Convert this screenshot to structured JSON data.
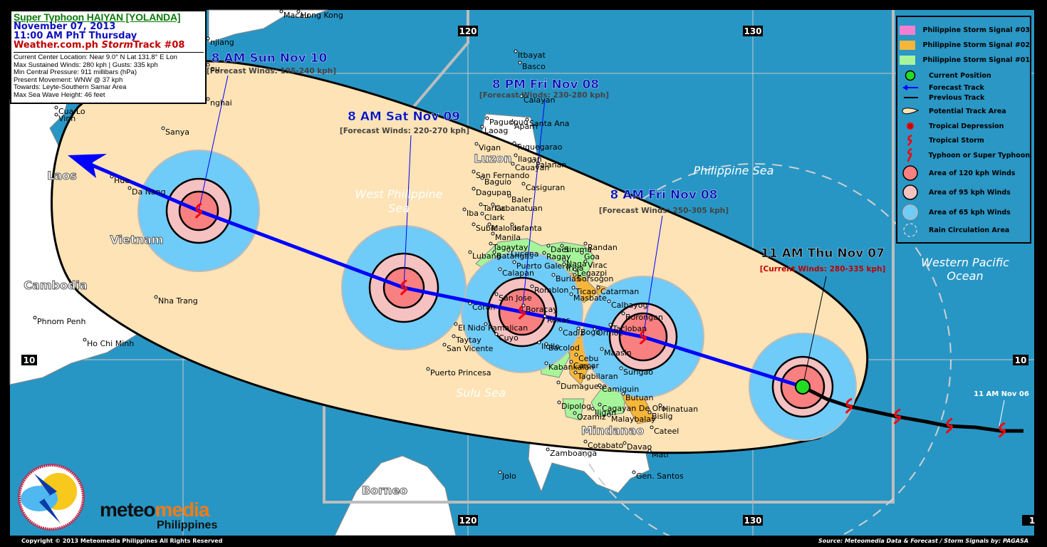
{
  "info": {
    "title": "Super Typhoon HAIYAN [YOLANDA]",
    "date": "November 07, 2013",
    "time": "11:00 AM PhT Thursday",
    "source_a": "Weather.com.ph ",
    "source_b": "Storm",
    "source_c": "Track #08",
    "details": [
      "Current Center Location: Near 9.0° N Lat  131.8° E Lon",
      "Max Sustained Winds: 280 kph | Gusts: 335 kph",
      "Min Central Pressure: 911 millibars (hPa)",
      "Present Movement: WNW @ 37 kph",
      "Towards: Leyte-Southern Samar Area",
      "Max Sea Wave Height: 46 feet"
    ]
  },
  "legend": {
    "items": [
      {
        "label": "Philippine Storm Signal #03",
        "icon": "signal-3-swatch",
        "color": "#f47fd0"
      },
      {
        "label": "Philippine Storm Signal #02",
        "icon": "signal-2-swatch",
        "color": "#f5b63a"
      },
      {
        "label": "Philippine Storm Signal #01",
        "icon": "signal-1-swatch",
        "color": "#a6f59a"
      },
      {
        "label": "Current Position",
        "icon": "current-position-icon",
        "color": "#22dd22"
      },
      {
        "label": "Forecast Track",
        "icon": "forecast-track-arrow-icon",
        "color": "#0000ff"
      },
      {
        "label": "Previous Track",
        "icon": "previous-track-line-icon",
        "color": "#000000"
      },
      {
        "label": "Potential Track Area",
        "icon": "potential-track-area-icon",
        "color": "#fde3b5"
      },
      {
        "label": "Tropical Depression",
        "icon": "tropical-depression-icon",
        "color": "#ff0000"
      },
      {
        "label": "Tropical Storm",
        "icon": "tropical-storm-icon",
        "color": "#ff0000"
      },
      {
        "label": "Typhoon or Super Typhoon",
        "icon": "typhoon-icon",
        "color": "#ff0000"
      },
      {
        "label": "Area of 120 kph Winds",
        "icon": "wind-120-icon",
        "color": "#f98080"
      },
      {
        "label": "Area of 95 kph Winds",
        "icon": "wind-95-icon",
        "color": "#f5c1c1"
      },
      {
        "label": "Area of 65 kph Winds",
        "icon": "wind-65-icon",
        "color": "#6fcbf7"
      },
      {
        "label": "Rain Circulation Area",
        "icon": "rain-circulation-icon",
        "color": "#cccccc"
      }
    ]
  },
  "grid": {
    "lon_top": [
      "120",
      "130"
    ],
    "lon_bottom": [
      "120",
      "130",
      "1"
    ],
    "lat": [
      "10",
      "10"
    ]
  },
  "current": {
    "time": "11 AM Thu Nov 07",
    "winds": "[Current Winds: 280-335 kph]"
  },
  "forecasts": [
    {
      "time": "8 AM Fri Nov 08",
      "winds": "[Forecast Winds: 250-305 kph]"
    },
    {
      "time": "8 PM Fri Nov 08",
      "winds": "[Forecast Winds: 230-280 kph]"
    },
    {
      "time": "8 AM Sat Nov 09",
      "winds": "[Forecast Winds: 220-270 kph]"
    },
    {
      "time": "8 AM Sun Nov 10",
      "winds": "[Forecast Winds: 195-240 kph]"
    }
  ],
  "previous_label": "11 AM Nov 06",
  "regions": [
    "Laos",
    "Vietnam",
    "Cambodia",
    "Luzon",
    "Mindanao",
    "Borneo"
  ],
  "seas": [
    "West Philippine",
    "Sea",
    "Sulu Sea",
    "Philippine Sea",
    "Western Pacific",
    "Ocean"
  ],
  "places": [
    "Macau",
    "Hong Kong",
    "njiang",
    "ou",
    "nghai",
    "Dongfang",
    "Sanya",
    "Cua Lo",
    "Vinh",
    "Hue",
    "Da Nang",
    "Nha Trang",
    "Phnom Penh",
    "Ho Chi Minh",
    "Itbayat",
    "Basco",
    "Calayan",
    "Pagudpud",
    "Aparri",
    "Santa Ana",
    "Laoag",
    "Vigan",
    "Tuguegarao",
    "Ilagan",
    "Cauayan",
    "Palanan",
    "San Fernando",
    "Baguio",
    "Dagupan",
    "Casiguran",
    "Baler",
    "Tarlac",
    "Cabanatuan",
    "Iba",
    "Clark",
    "Subic",
    "Malolos",
    "Infanta",
    "Manila",
    "Tagaytay",
    "Lucena",
    "Randan",
    "Daet",
    "Siruma",
    "Lubang",
    "Batangas",
    "Ragay",
    "Goa",
    "Puerto Galera",
    "Naga",
    "Virac",
    "Calapan",
    "Iriga",
    "Legazpi",
    "Burias",
    "Sorsogon",
    "Romblon",
    "Ticao",
    "Catarman",
    "Masbate",
    "Calbayog",
    "San Jose",
    "Boracay",
    "Coron",
    "Borongan",
    "Roxas",
    "El Nido",
    "Pamalican",
    "Tacloban",
    "Cuyo",
    "Cadiz",
    "Bogo",
    "Ormoc",
    "Iloilo",
    "Bacolod",
    "Taytay",
    "San Vicente",
    "Maasin",
    "Cebu",
    "Carcar",
    "Kabankalan",
    "Puerto Princesa",
    "Surigao",
    "Tagbilaran",
    "Dumaguete",
    "Camiguin",
    "Butuan",
    "Dipolog",
    "Cagayan De Oro",
    "Iligan",
    "Ozamiz",
    "Malaybalay",
    "Hinatuan",
    "Bislig",
    "Cateel",
    "Cotabato",
    "Davao",
    "Mati",
    "Zamboanga",
    "Gen. Santos",
    "Jolo"
  ],
  "logo": {
    "brand_a": "meteo",
    "brand_b": "media",
    "sub": "Philippines"
  },
  "footer": {
    "copyright": "Copyright © 2013 Meteomedia Philippines   All Rights Reserved",
    "source": "Source:  Meteomedia Data & Forecast  /  Storm Signals by: PAGASA"
  },
  "colors": {
    "ocean": "#2896c4",
    "cone": "#fde3b5",
    "forecast_track": "#0000ff",
    "previous_track": "#000000"
  }
}
